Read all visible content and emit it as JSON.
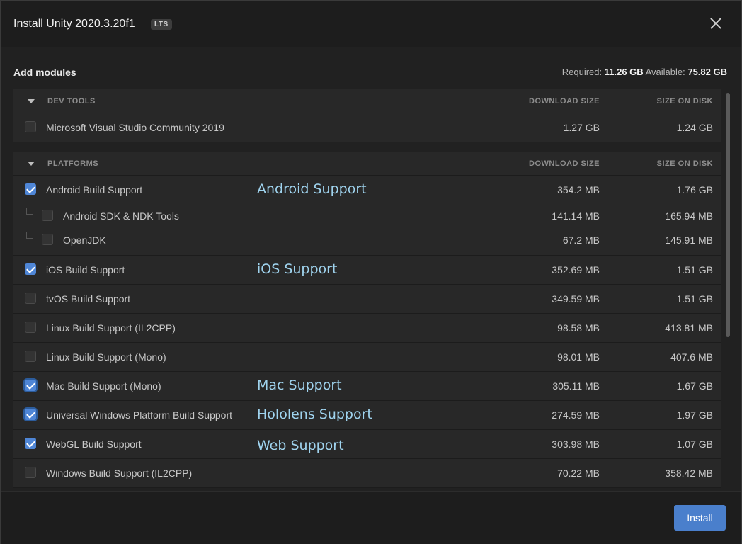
{
  "dialog": {
    "title": "Install Unity 2020.3.20f1",
    "badge": "LTS",
    "subtitle": "Add modules",
    "required_label": "Required:",
    "required_value": "11.26 GB",
    "available_label": "Available:",
    "available_value": "75.82 GB"
  },
  "columns": {
    "download_size": "DOWNLOAD SIZE",
    "size_on_disk": "SIZE ON DISK"
  },
  "sections": {
    "dev_tools": {
      "title": "DEV TOOLS",
      "rows": [
        {
          "label": "Microsoft Visual Studio Community 2019",
          "download": "1.27 GB",
          "disk": "1.24 GB",
          "checked": false
        }
      ]
    },
    "platforms": {
      "title": "PLATFORMS",
      "rows": [
        {
          "label": "Android Build Support",
          "download": "354.2 MB",
          "disk": "1.76 GB",
          "checked": true,
          "annotation": "Android Support"
        },
        {
          "label": "Android SDK & NDK Tools",
          "download": "141.14 MB",
          "disk": "165.94 MB",
          "checked": false
        },
        {
          "label": "OpenJDK",
          "download": "67.2 MB",
          "disk": "145.91 MB",
          "checked": false
        },
        {
          "label": "iOS Build Support",
          "download": "352.69 MB",
          "disk": "1.51 GB",
          "checked": true,
          "annotation": "iOS Support"
        },
        {
          "label": "tvOS Build Support",
          "download": "349.59 MB",
          "disk": "1.51 GB",
          "checked": false
        },
        {
          "label": "Linux Build Support (IL2CPP)",
          "download": "98.58 MB",
          "disk": "413.81 MB",
          "checked": false
        },
        {
          "label": "Linux Build Support (Mono)",
          "download": "98.01 MB",
          "disk": "407.6 MB",
          "checked": false
        },
        {
          "label": "Mac Build Support (Mono)",
          "download": "305.11 MB",
          "disk": "1.67 GB",
          "checked": true,
          "annotation": "Mac Support"
        },
        {
          "label": "Universal Windows Platform Build Support",
          "download": "274.59 MB",
          "disk": "1.97 GB",
          "checked": true,
          "annotation": "Hololens Support"
        },
        {
          "label": "WebGL Build Support",
          "download": "303.98 MB",
          "disk": "1.07 GB",
          "checked": true,
          "annotation": "Web Support"
        },
        {
          "label": "Windows Build Support (IL2CPP)",
          "download": "70.22 MB",
          "disk": "358.42 MB",
          "checked": false
        }
      ]
    }
  },
  "footer": {
    "install_label": "Install"
  },
  "colors": {
    "accent": "#4a7fcc",
    "annotation": "#9fd3ee"
  }
}
